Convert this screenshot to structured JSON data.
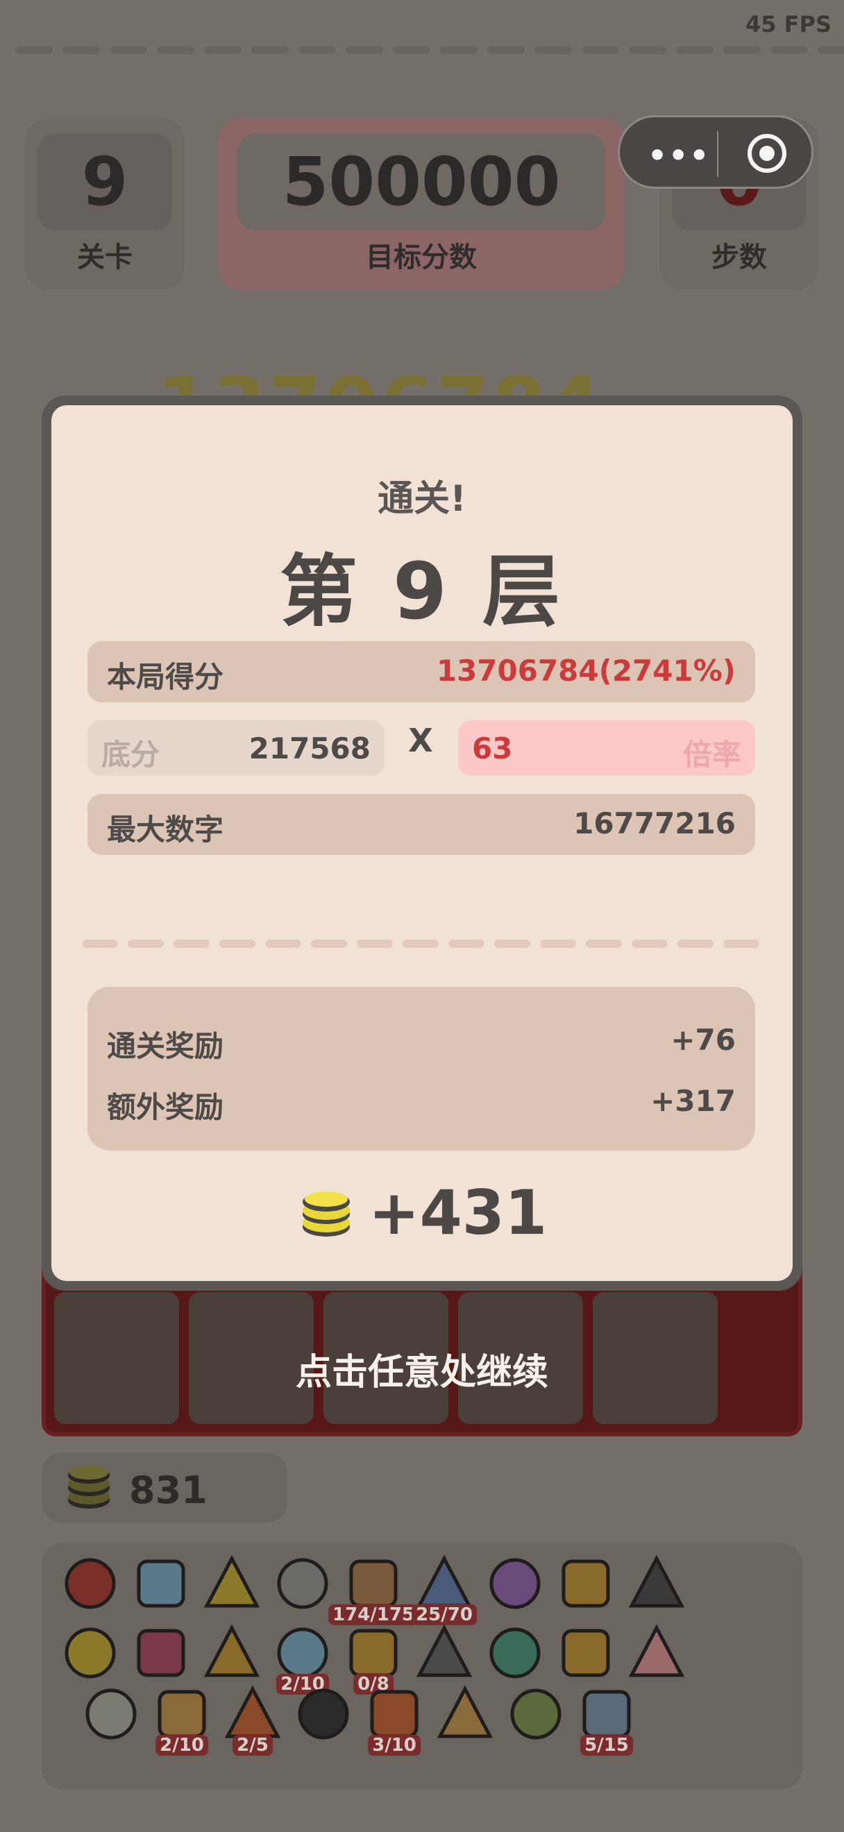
{
  "fps": "45 FPS",
  "stats": {
    "level": {
      "value": "9",
      "label": "关卡"
    },
    "target": {
      "value": "500000",
      "label": "目标分数"
    },
    "steps": {
      "value": "0",
      "label": "步数"
    }
  },
  "menu_capsule": {
    "more": "•••",
    "icons": [
      "more-icon",
      "target-ring-icon"
    ]
  },
  "bg_score": "13706784",
  "result": {
    "subtitle": "通关!",
    "title": "第 9 层",
    "round_score": {
      "label": "本局得分",
      "value": "13706784(2741%)"
    },
    "base": {
      "label": "底分",
      "value": "217568"
    },
    "times": "X",
    "multiplier": {
      "value": "63",
      "label": "倍率"
    },
    "max_number": {
      "label": "最大数字",
      "value": "16777216"
    },
    "rewards": [
      {
        "label": "通关奖励",
        "value": "+76"
      },
      {
        "label": "额外奖励",
        "value": "+317"
      }
    ],
    "total": "+431"
  },
  "continue_hint": "点击任意处继续",
  "coins": "831",
  "inventory": [
    {
      "icon": "demon-mask-icon",
      "badge": ""
    },
    {
      "icon": "ice-cube-icon",
      "badge": ""
    },
    {
      "icon": "gold-coin-icon",
      "badge": ""
    },
    {
      "icon": "candle-icon",
      "badge": ""
    },
    {
      "icon": "eye-gear-icon",
      "badge": "174/175"
    },
    {
      "icon": "compass-icon",
      "badge": "25/70"
    },
    {
      "icon": "crystal-icon",
      "badge": ""
    },
    {
      "icon": "money-bag-icon",
      "badge": ""
    },
    {
      "icon": "skull-shield-icon",
      "badge": ""
    },
    {
      "icon": "swords-coin-icon",
      "badge": ""
    },
    {
      "icon": "boot-icon",
      "badge": ""
    },
    {
      "icon": "crown-icon",
      "badge": ""
    },
    {
      "icon": "potion-bottle-icon",
      "badge": "2/10"
    },
    {
      "icon": "gold-ring-icon",
      "badge": "0/8"
    },
    {
      "icon": "pen-icon",
      "badge": ""
    },
    {
      "icon": "eye-pyramid-icon",
      "badge": ""
    },
    {
      "icon": "treasure-chest-icon",
      "badge": ""
    },
    {
      "icon": "piggy-bank-icon",
      "badge": ""
    },
    {
      "icon": "scroll-list-icon",
      "badge": ""
    },
    {
      "icon": "bronze-ring-icon",
      "badge": "2/10"
    },
    {
      "icon": "fire-box-icon",
      "badge": "2/5"
    },
    {
      "icon": "ninja-mask-icon",
      "badge": ""
    },
    {
      "icon": "fire-shield-icon",
      "badge": "3/10"
    },
    {
      "icon": "broken-ring-icon",
      "badge": ""
    },
    {
      "icon": "flute-icon",
      "badge": ""
    },
    {
      "icon": "hourglass-icon",
      "badge": "5/15"
    }
  ],
  "colors": {
    "overlay_bg": "#756f6a",
    "modal_card": "#f2e2d6",
    "row_bg": "#ddc5b6",
    "accent_red": "#cc3b3b",
    "multiplier_bg": "#fdc9c8"
  }
}
